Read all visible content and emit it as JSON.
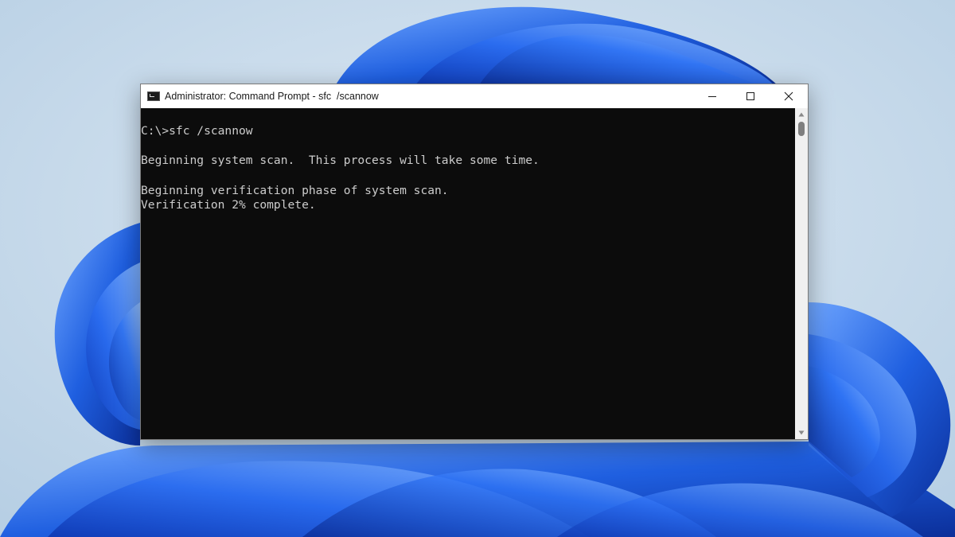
{
  "window": {
    "title": "Administrator: Command Prompt - sfc  /scannow",
    "icon": "cmd-icon"
  },
  "caption_buttons": {
    "minimize_icon": "minimize-icon",
    "maximize_icon": "maximize-icon",
    "close_icon": "close-icon"
  },
  "console": {
    "lines": [
      "C:\\>sfc /scannow",
      "",
      "Beginning system scan.  This process will take some time.",
      "",
      "Beginning verification phase of system scan.",
      "Verification 2% complete."
    ]
  },
  "colors": {
    "console_bg": "#0c0c0c",
    "console_text": "#cccccc",
    "titlebar_bg": "#ffffff",
    "wallpaper_bg": "#c9dcec",
    "wallpaper_accent": "#1f5fe0"
  }
}
